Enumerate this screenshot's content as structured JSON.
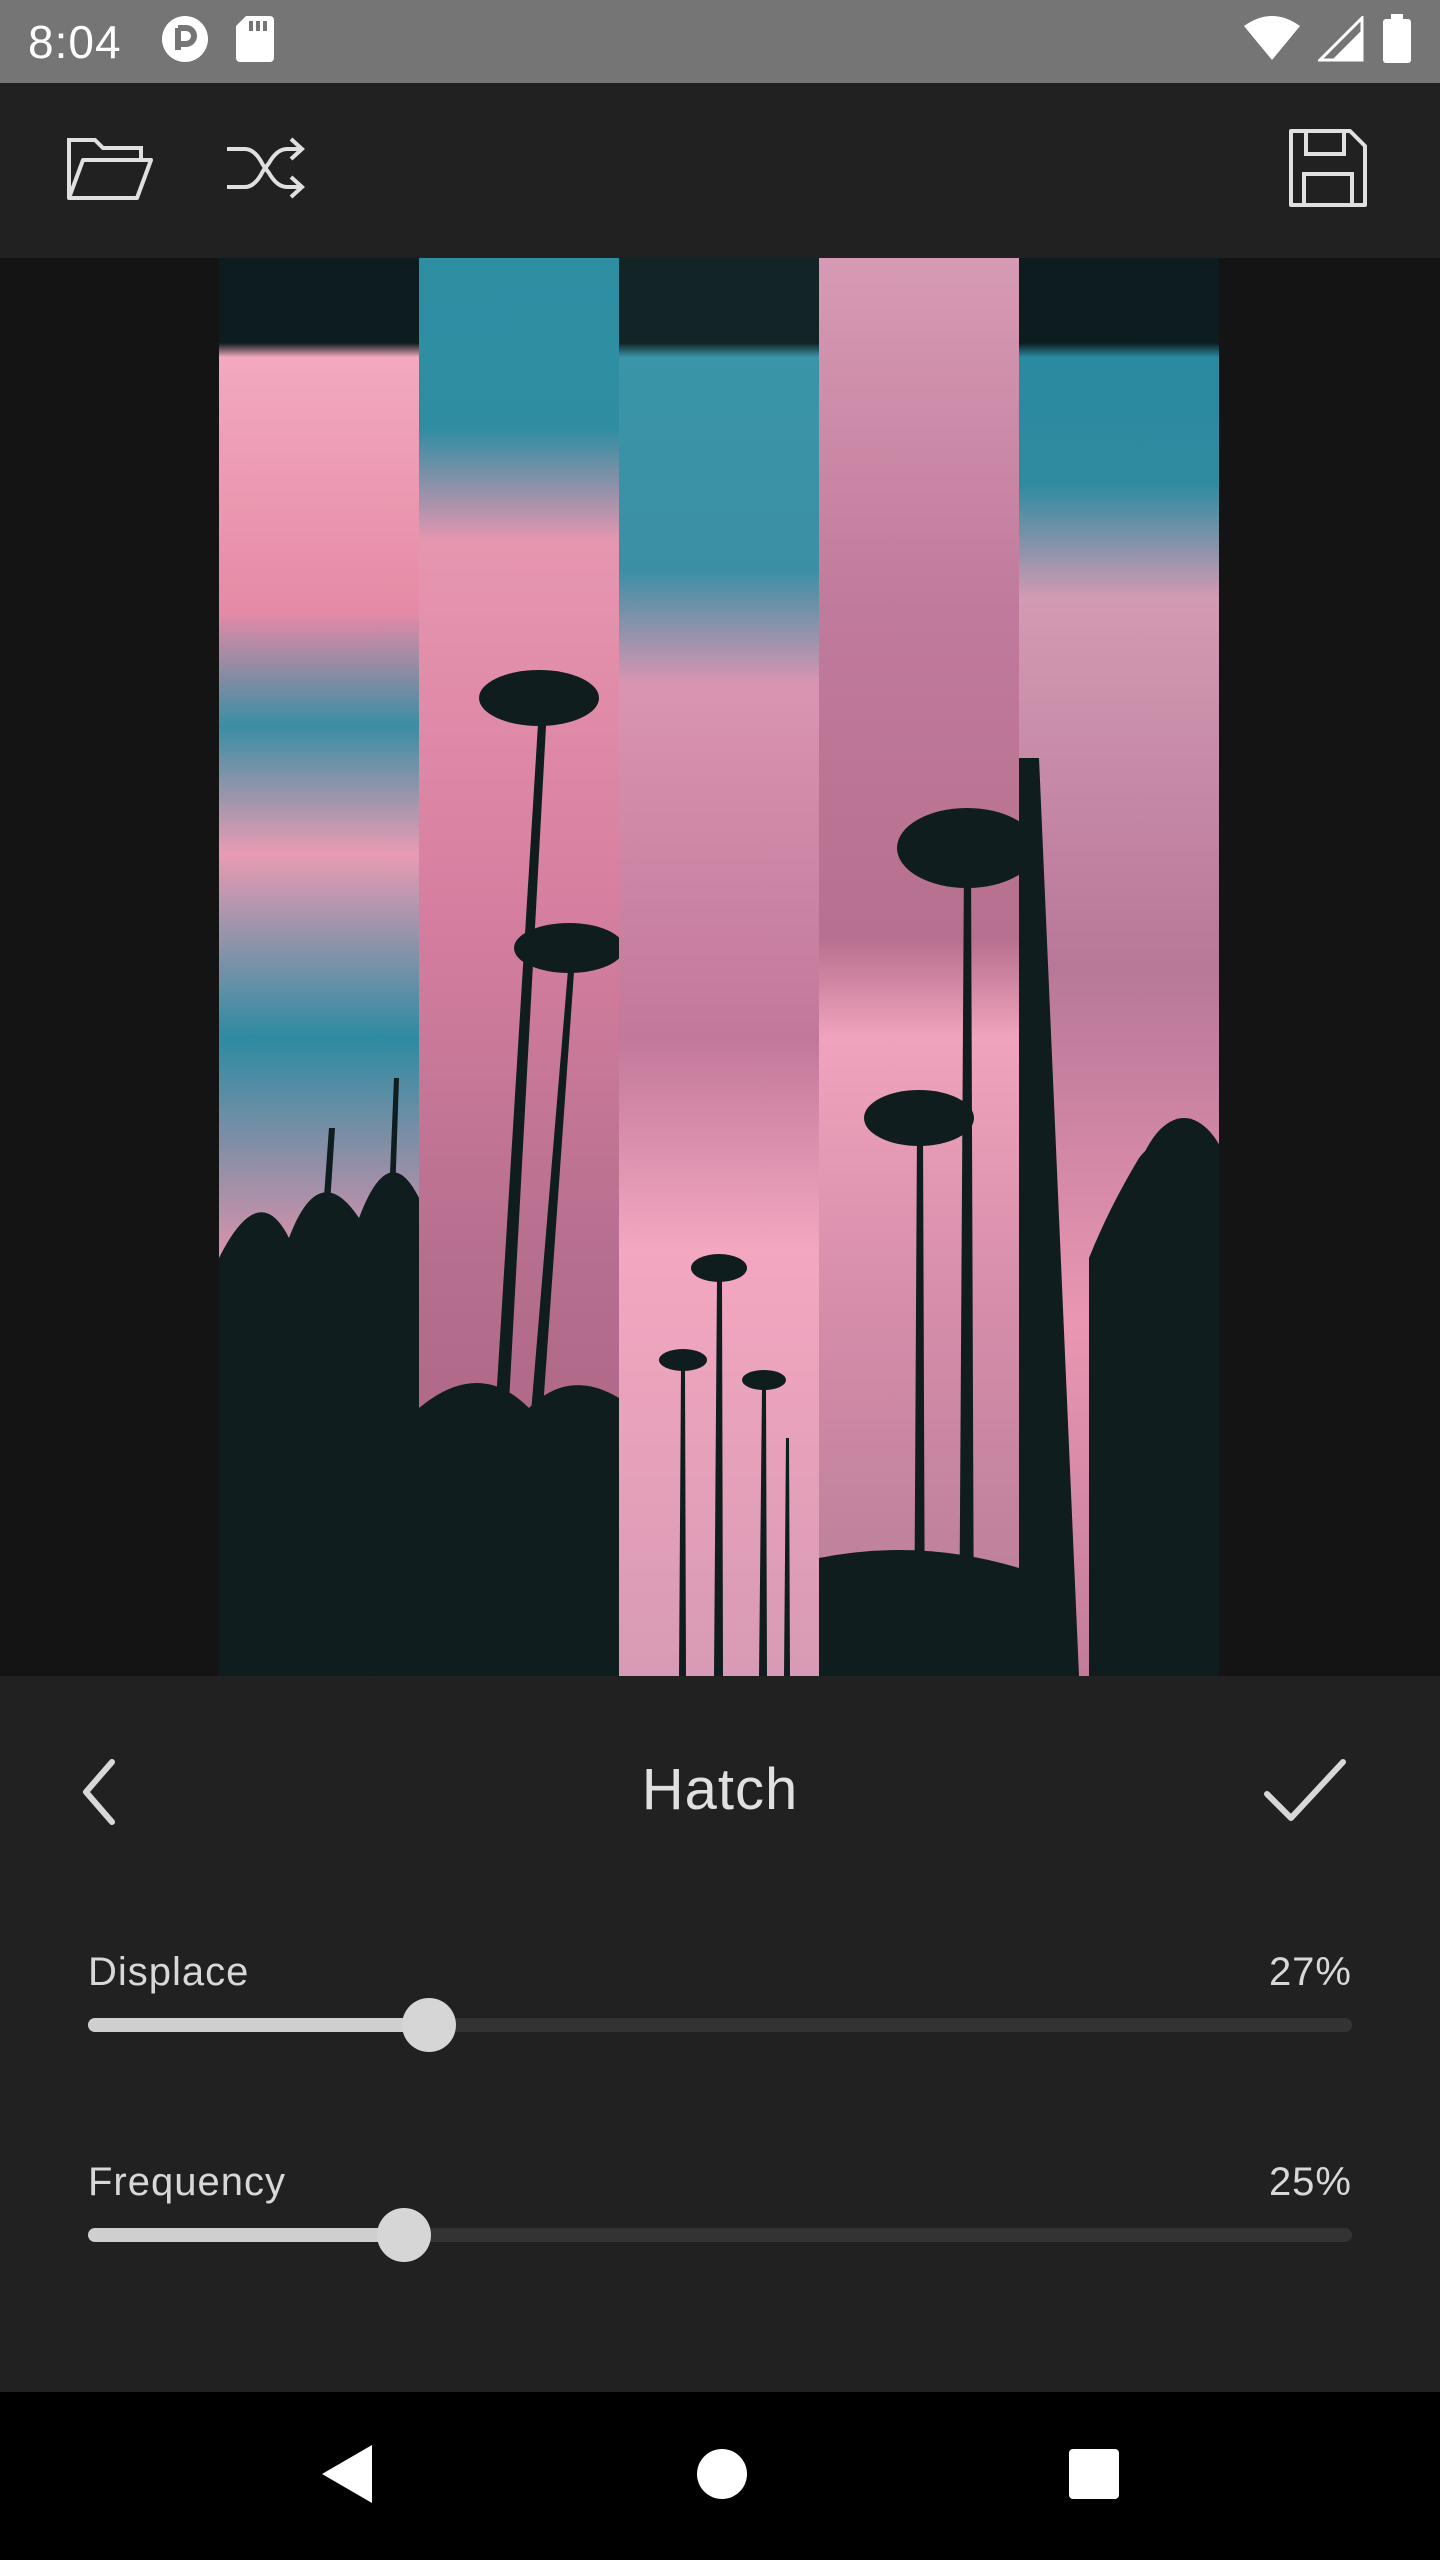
{
  "status_bar": {
    "time": "8:04",
    "left_icons": [
      "notification-app-icon",
      "sd-card-icon"
    ],
    "right_icons": [
      "wifi-icon",
      "cell-signal-icon",
      "battery-icon"
    ]
  },
  "toolbar": {
    "icons": [
      "open-folder-icon",
      "shuffle-icon",
      "save-icon"
    ]
  },
  "canvas": {
    "description_icon": "photo-preview",
    "strip_count": 5
  },
  "effect_panel": {
    "title": "Hatch",
    "back_icon": "chevron-left-icon",
    "apply_icon": "check-icon",
    "sliders": [
      {
        "label": "Displace",
        "value_text": "27%",
        "value": 0.27
      },
      {
        "label": "Frequency",
        "value_text": "25%",
        "value": 0.25
      }
    ]
  },
  "nav_bar": {
    "icons": [
      "back-triangle-icon",
      "home-circle-icon",
      "recents-square-icon"
    ]
  },
  "colors": {
    "status_bar": "#757575",
    "toolbar": "#212121",
    "canvas_bg": "#141414",
    "panel": "#212121",
    "accent": "#d6d6d6",
    "sky_pink": "#e88aa8",
    "sky_teal": "#2f8fa3",
    "silhouette": "#0f1d1f"
  }
}
